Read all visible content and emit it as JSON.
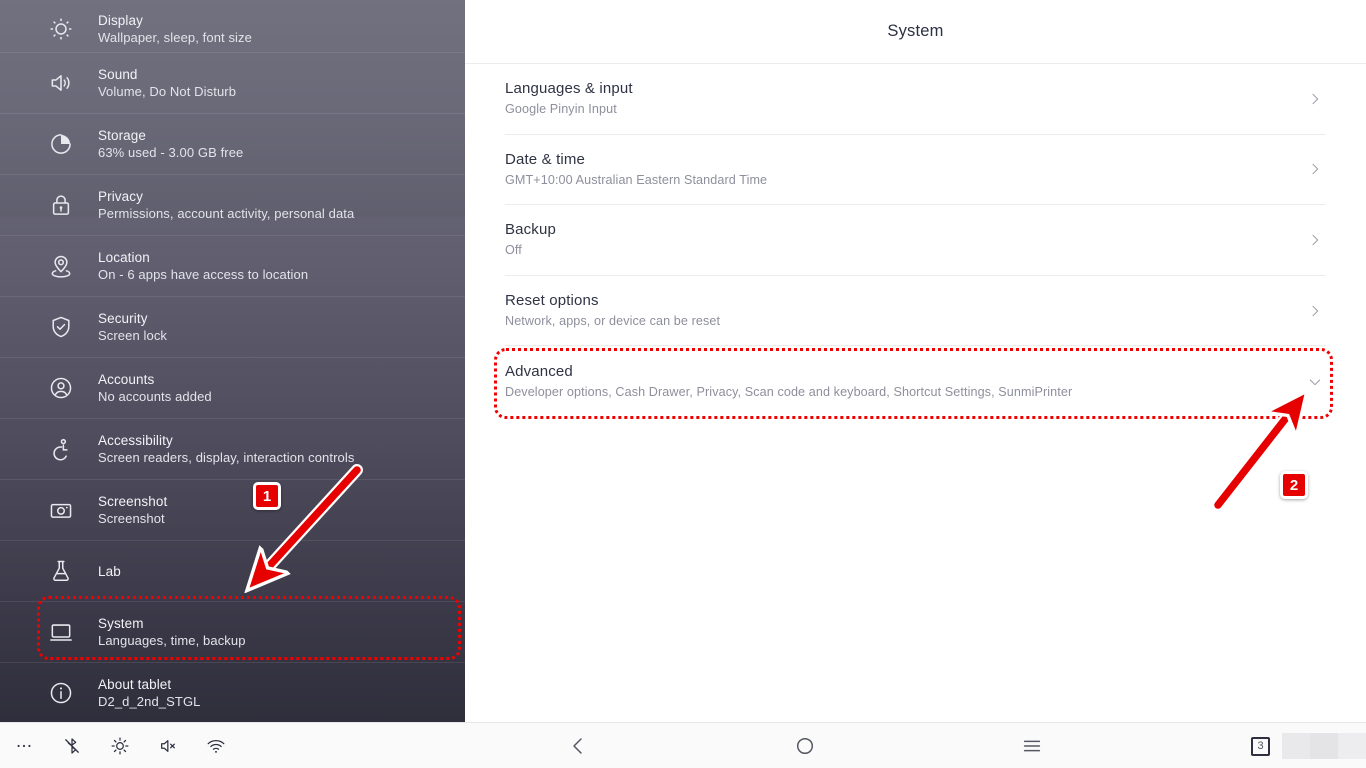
{
  "sidebar": {
    "items": [
      {
        "icon": "brightness-icon",
        "title": "Display",
        "sub": "Wallpaper, sleep, font size"
      },
      {
        "icon": "sound-icon",
        "title": "Sound",
        "sub": "Volume, Do Not Disturb"
      },
      {
        "icon": "storage-pie-icon",
        "title": "Storage",
        "sub": "63% used - 3.00 GB free"
      },
      {
        "icon": "lock-icon",
        "title": "Privacy",
        "sub": "Permissions, account activity, personal data"
      },
      {
        "icon": "location-pin-icon",
        "title": "Location",
        "sub": "On - 6 apps have access to location"
      },
      {
        "icon": "shield-check-icon",
        "title": "Security",
        "sub": "Screen lock"
      },
      {
        "icon": "account-circle-icon",
        "title": "Accounts",
        "sub": "No accounts added"
      },
      {
        "icon": "accessibility-icon",
        "title": "Accessibility",
        "sub": "Screen readers, display, interaction controls"
      },
      {
        "icon": "camera-icon",
        "title": "Screenshot",
        "sub": "Screenshot"
      },
      {
        "icon": "flask-icon",
        "title": "Lab",
        "sub": ""
      },
      {
        "icon": "monitor-icon",
        "title": "System",
        "sub": "Languages, time, backup"
      },
      {
        "icon": "info-circle-icon",
        "title": "About tablet",
        "sub": "D2_d_2nd_STGL"
      }
    ]
  },
  "panel": {
    "title": "System",
    "rows": [
      {
        "title": "Languages & input",
        "sub": "Google Pinyin Input",
        "chevron": "chevron-right-icon"
      },
      {
        "title": "Date & time",
        "sub": "GMT+10:00 Australian Eastern Standard Time",
        "chevron": "chevron-right-icon"
      },
      {
        "title": "Backup",
        "sub": "Off",
        "chevron": "chevron-right-icon"
      },
      {
        "title": "Reset options",
        "sub": "Network, apps, or device can be reset",
        "chevron": "chevron-right-icon"
      },
      {
        "title": "Advanced",
        "sub": "Developer options, Cash Drawer, Privacy, Scan code and keyboard, Shortcut Settings, SunmiPrinter",
        "chevron": "chevron-down-icon"
      }
    ]
  },
  "navbar": {
    "left_icons": [
      {
        "name": "more-options-icon"
      },
      {
        "name": "bluetooth-off-icon"
      },
      {
        "name": "brightness-icon"
      },
      {
        "name": "volume-mute-icon"
      },
      {
        "name": "wifi-icon"
      }
    ],
    "center_icons": [
      {
        "name": "back-icon"
      },
      {
        "name": "home-icon"
      },
      {
        "name": "recents-menu-icon"
      }
    ],
    "recents_count": "3"
  },
  "annotations": {
    "badge1": "1",
    "badge2": "2",
    "highlight_color": "#f00000",
    "badge_color": "#e60000",
    "step1_target": "System",
    "step2_target": "Advanced"
  }
}
